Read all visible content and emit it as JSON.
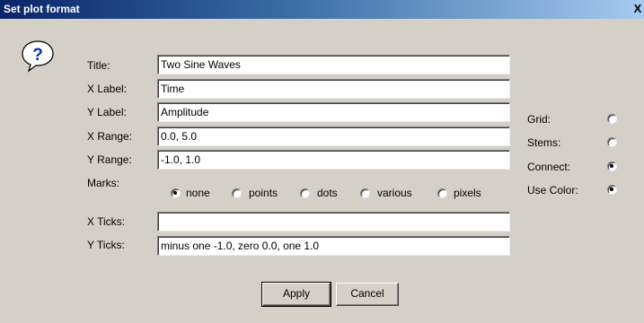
{
  "window": {
    "title": "Set plot format",
    "close_label": "X"
  },
  "labels": {
    "title": "Title:",
    "xlabel": "X Label:",
    "ylabel": "Y Label:",
    "xrange": "X Range:",
    "yrange": "Y Range:",
    "marks": "Marks:",
    "xticks": "X Ticks:",
    "yticks": "Y Ticks:"
  },
  "fields": {
    "title": "Two Sine Waves",
    "xlabel": "Time",
    "ylabel": "Amplitude",
    "xrange": "0.0, 5.0",
    "yrange": "-1.0, 1.0",
    "xticks": "",
    "yticks": "minus one -1.0, zero 0.0, one 1.0"
  },
  "marks": {
    "options": [
      "none",
      "points",
      "dots",
      "various",
      "pixels"
    ],
    "selected": "none"
  },
  "options": {
    "grid": {
      "label": "Grid:",
      "checked": false
    },
    "stems": {
      "label": "Stems:",
      "checked": false
    },
    "connect": {
      "label": "Connect:",
      "checked": true
    },
    "use_color": {
      "label": "Use Color:",
      "checked": true
    }
  },
  "buttons": {
    "apply": "Apply",
    "cancel": "Cancel"
  },
  "icon": {
    "name": "question-icon",
    "glyph": "?"
  }
}
